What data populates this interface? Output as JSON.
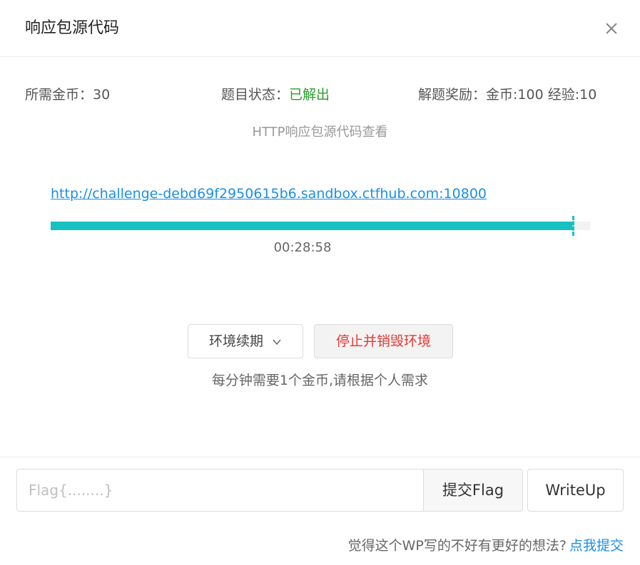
{
  "dialog": {
    "title": "响应包源代码",
    "close_icon": "close-icon"
  },
  "info": {
    "cost_label": "所需金币：",
    "cost_value": "30",
    "status_label": "题目状态：",
    "status_value": "已解出",
    "status_color": "#2a9d2a",
    "reward_label": "解题奖励：",
    "reward_value": "金币:100 经验:10"
  },
  "subtitle": "HTTP响应包源代码查看",
  "environment": {
    "url": "http://challenge-debd69f2950615b6.sandbox.ctfhub.com:10800",
    "progress_fraction": 0.967,
    "progress_color": "#17c1c1",
    "timer": "00:28:58"
  },
  "actions": {
    "renew_label": "环境续期",
    "renew_icon": "chevron-down-icon",
    "destroy_label": "停止并销毁环境",
    "destroy_color": "#e53935"
  },
  "note": "每分钟需要1个金币,请根据个人需求",
  "flag": {
    "placeholder": "Flag{........}",
    "value": "",
    "submit_label": "提交Flag",
    "writeup_label": "WriteUp"
  },
  "feedback": {
    "text": "觉得这个WP写的不好有更好的想法?",
    "link_label": "点我提交"
  }
}
